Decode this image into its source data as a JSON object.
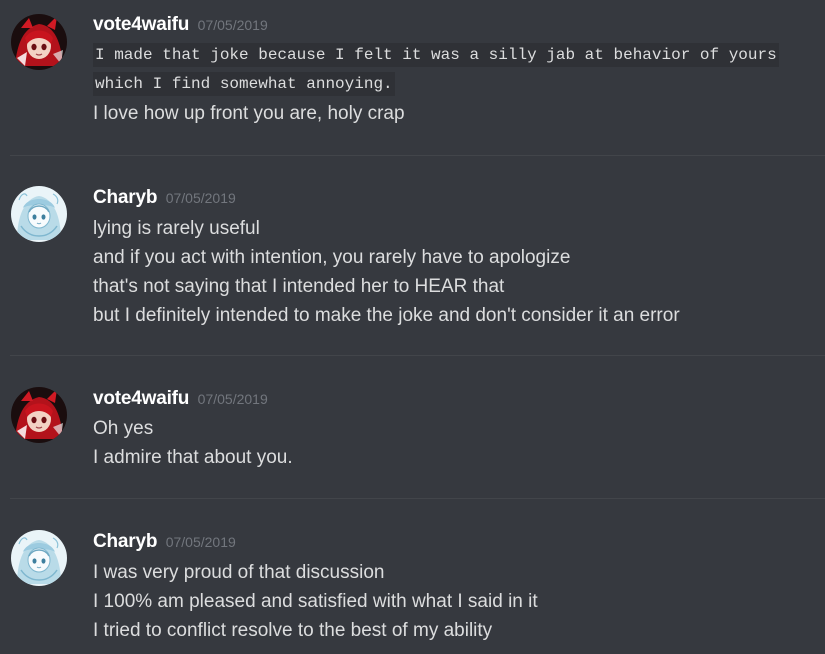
{
  "messages": [
    {
      "author": "vote4waifu",
      "timestamp": "07/05/2019",
      "avatar_icon": "red-haired-anime-avatar-icon",
      "code_lines": [
        "I made that joke because I felt it was a silly jab at behavior of yours",
        "which I find somewhat annoying."
      ],
      "lines": [
        "I love how up front you are, holy crap"
      ]
    },
    {
      "author": "Charyb",
      "timestamp": "07/05/2019",
      "avatar_icon": "blue-sketch-anime-avatar-icon",
      "lines": [
        "lying is rarely useful",
        "and if you act with intention, you rarely have to apologize",
        "that's not saying that I intended her to HEAR that",
        "but I definitely intended to make the joke and don't consider it an error"
      ]
    },
    {
      "author": "vote4waifu",
      "timestamp": "07/05/2019",
      "avatar_icon": "red-haired-anime-avatar-icon",
      "lines": [
        "Oh yes",
        "I admire that about you."
      ]
    },
    {
      "author": "Charyb",
      "timestamp": "07/05/2019",
      "avatar_icon": "blue-sketch-anime-avatar-icon",
      "lines": [
        "I was very proud of that discussion",
        "I 100% am pleased and satisfied with what I said in it",
        "I tried to conflict resolve to the best of my ability"
      ]
    }
  ],
  "colors": {
    "background": "#36393f",
    "username": "#ffffff",
    "timestamp": "#72767d",
    "message_text": "#dcddde",
    "code_background": "#2f3136",
    "divider": "#42454a"
  }
}
